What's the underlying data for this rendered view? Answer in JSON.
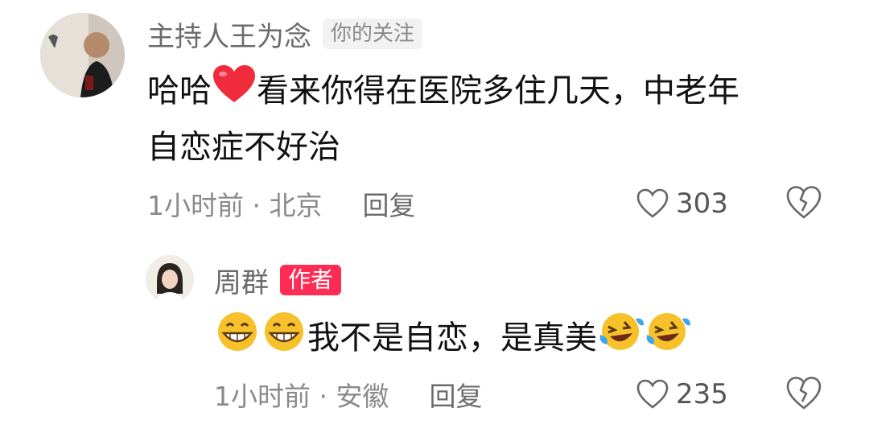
{
  "comments": [
    {
      "username": "主持人王为念",
      "badge": "你的关注",
      "text_prefix": "哈哈",
      "text_emoji": "heart-emoji",
      "text_line1_rest": "看来你得在医院多住几天，中老年",
      "text_line2": "自恋症不好治",
      "time_location": "1小时前 · 北京",
      "reply_label": "回复",
      "likes": "303",
      "avatar_icon": "host-avatar-photo"
    },
    {
      "username": "周群",
      "badge": "作者",
      "text": "我不是自恋，是真美",
      "emojis_before": [
        "grinning-emoji",
        "grinning-emoji"
      ],
      "emojis_after": [
        "laughing-tears-emoji",
        "laughing-tears-emoji"
      ],
      "time_location": "1小时前 · 安徽",
      "reply_label": "回复",
      "likes": "235",
      "avatar_icon": "author-avatar-photo"
    }
  ],
  "colors": {
    "author_badge": "#fe2c55",
    "follow_badge_bg": "#f2f2f2",
    "meta_text": "#8a8a8a"
  }
}
